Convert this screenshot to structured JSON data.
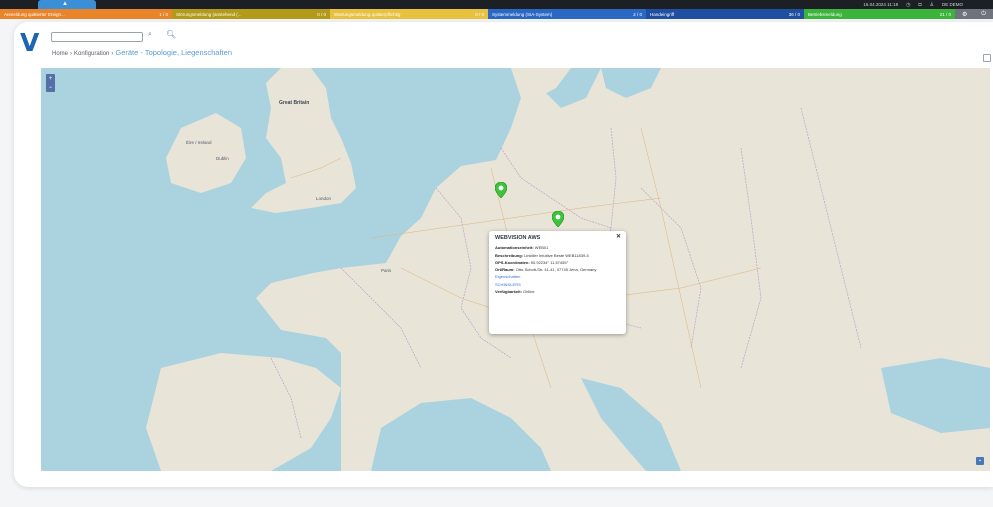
{
  "topbar": {
    "datetime": "16.04.2024 11:18",
    "user": "DE DEMO"
  },
  "status_strip": [
    {
      "label": "Anmeldung quittierter Ereign...",
      "count": "1 / 0",
      "color": "#e8852a",
      "width": 172
    },
    {
      "label": "Störungsmeldung (anstehend (...",
      "count": "0 / 0",
      "color": "#b39a18",
      "width": 158
    },
    {
      "label": "Wartungsmeldung quittierpflichtig",
      "count": "0 / 0",
      "color": "#e8c13e",
      "width": 158
    },
    {
      "label": "Systemmeldung (SIA-System)",
      "count": "2 / 0",
      "color": "#2a68c4",
      "width": 158
    },
    {
      "label": "Handeingriff",
      "count": "36 / 0",
      "color": "#1f4fa0",
      "width": 158
    },
    {
      "label": "Betriebsmeldung",
      "count": "21 / 0",
      "color": "#3cb43c",
      "width": 151
    }
  ],
  "header": {
    "logo": "V",
    "search_value": ""
  },
  "breadcrumb": {
    "home": "Home",
    "sep": "›",
    "level1": "Konfiguration",
    "current": "Geräte - Topologie, Liegenschaften"
  },
  "map": {
    "labels": {
      "great_britain": "Great Britain",
      "ireland": "Éire / Ireland",
      "dublin": "Dublin",
      "london": "London",
      "paris": "Paris"
    }
  },
  "popup": {
    "title": "WEBVISION AWS",
    "rows": [
      {
        "key": "Automationseinheit:",
        "value": "WEB01"
      },
      {
        "key": "Beschreibung:",
        "value": "Linktiler Intuitive Beste WEB11839-5"
      },
      {
        "key": "GPS-Koordinaten:",
        "value": "50.92234° 11.57455°"
      },
      {
        "key": "Ort/Raum:",
        "value": "Otto-Schott-Str. 41-41, 07745 Jena, Germany"
      }
    ],
    "links": [
      "Eigenschaften",
      "SCHINDLERS"
    ],
    "availability_key": "Verfügbarkeit:",
    "availability_value": "Online"
  }
}
